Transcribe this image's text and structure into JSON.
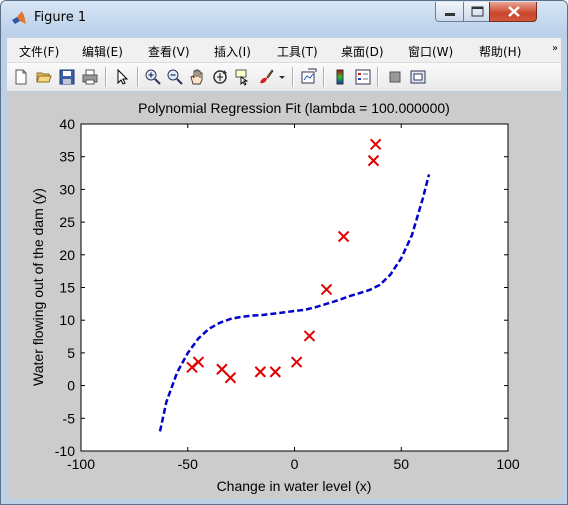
{
  "window": {
    "title": "Figure 1",
    "controls": [
      "minimize",
      "maximize",
      "close"
    ]
  },
  "menu": {
    "items": [
      "文件(F)",
      "编辑(E)",
      "查看(V)",
      "插入(I)",
      "工具(T)",
      "桌面(D)",
      "窗口(W)",
      "帮助(H)"
    ],
    "more": "»"
  },
  "toolbar": {
    "icons": [
      "new-file-icon",
      "open-folder-icon",
      "save-icon",
      "print-icon",
      "pointer-icon",
      "zoom-in-icon",
      "zoom-out-icon",
      "pan-hand-icon",
      "rotate-3d-icon",
      "data-cursor-icon",
      "brush-icon",
      "link-plot-icon",
      "colorbar-icon",
      "legend-icon",
      "hide-plot-tools-icon",
      "show-plot-tools-icon"
    ]
  },
  "chart_data": {
    "type": "scatter",
    "title": "Polynomial Regression Fit (lambda = 100.000000)",
    "xlabel": "Change in water level (x)",
    "ylabel": "Water flowing out of the dam (y)",
    "xlim": [
      -100,
      100
    ],
    "ylim": [
      -10,
      40
    ],
    "xticks": [
      -100,
      -50,
      0,
      50,
      100
    ],
    "yticks": [
      -10,
      -5,
      0,
      5,
      10,
      15,
      20,
      25,
      30,
      35,
      40
    ],
    "grid": false,
    "legend": "none",
    "series": [
      {
        "kind": "scatter",
        "marker": "x",
        "color": "#e00000",
        "points": [
          {
            "x": -48,
            "y": 2.8
          },
          {
            "x": -45,
            "y": 3.6
          },
          {
            "x": -34,
            "y": 2.5
          },
          {
            "x": -30,
            "y": 1.2
          },
          {
            "x": -16,
            "y": 2.1
          },
          {
            "x": -9,
            "y": 2.1
          },
          {
            "x": 1,
            "y": 3.6
          },
          {
            "x": 7,
            "y": 7.6
          },
          {
            "x": 15,
            "y": 14.7
          },
          {
            "x": 23,
            "y": 22.8
          },
          {
            "x": 37,
            "y": 34.4
          },
          {
            "x": 38,
            "y": 36.9
          }
        ]
      },
      {
        "kind": "line",
        "style": "dashed",
        "color": "#0000cc",
        "points": [
          {
            "x": -63,
            "y": -7
          },
          {
            "x": -60,
            "y": -2.5
          },
          {
            "x": -55,
            "y": 2.0
          },
          {
            "x": -50,
            "y": 5.0
          },
          {
            "x": -45,
            "y": 7.2
          },
          {
            "x": -40,
            "y": 8.7
          },
          {
            "x": -35,
            "y": 9.6
          },
          {
            "x": -30,
            "y": 10.2
          },
          {
            "x": -25,
            "y": 10.5
          },
          {
            "x": -20,
            "y": 10.7
          },
          {
            "x": -15,
            "y": 10.8
          },
          {
            "x": -10,
            "y": 11.0
          },
          {
            "x": -5,
            "y": 11.2
          },
          {
            "x": 0,
            "y": 11.4
          },
          {
            "x": 5,
            "y": 11.6
          },
          {
            "x": 10,
            "y": 12.0
          },
          {
            "x": 15,
            "y": 12.5
          },
          {
            "x": 20,
            "y": 13.0
          },
          {
            "x": 25,
            "y": 13.6
          },
          {
            "x": 30,
            "y": 14.1
          },
          {
            "x": 35,
            "y": 14.6
          },
          {
            "x": 40,
            "y": 15.4
          },
          {
            "x": 45,
            "y": 17.0
          },
          {
            "x": 50,
            "y": 19.5
          },
          {
            "x": 55,
            "y": 23.0
          },
          {
            "x": 60,
            "y": 28.5
          },
          {
            "x": 63,
            "y": 32.3
          }
        ]
      }
    ]
  }
}
